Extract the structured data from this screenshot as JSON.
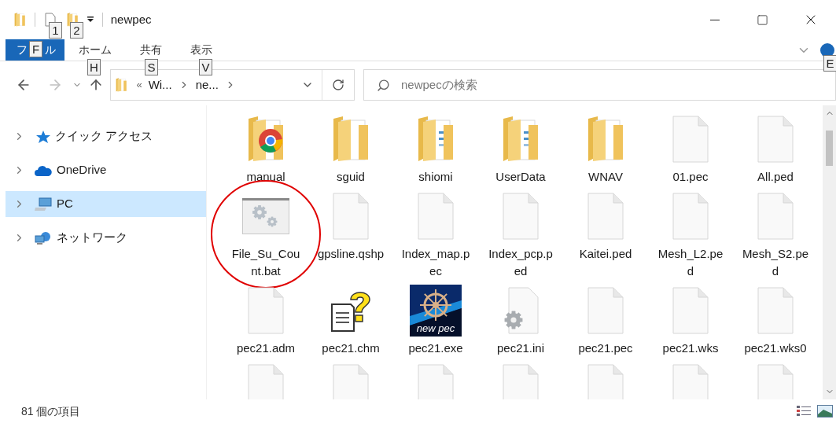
{
  "window": {
    "title": "newpec"
  },
  "keytips": [
    {
      "key": "1",
      "kind": "qat1"
    },
    {
      "key": "2",
      "kind": "qat2"
    },
    {
      "key": "F",
      "kind": "file"
    },
    {
      "key": "H",
      "kind": "home"
    },
    {
      "key": "S",
      "kind": "share"
    },
    {
      "key": "V",
      "kind": "view"
    },
    {
      "key": "E",
      "kind": "help"
    }
  ],
  "ribbon": {
    "file_tab": {
      "visible_parts": [
        "フ",
        "ル"
      ],
      "selected": true
    },
    "tabs": [
      {
        "label": "ホーム",
        "selected": false
      },
      {
        "label": "共有",
        "selected": false
      },
      {
        "label": "表示",
        "selected": false
      }
    ]
  },
  "address": {
    "overflow": "«",
    "crumbs": [
      "Wi...",
      "ne..."
    ]
  },
  "search": {
    "placeholder": "newpecの検索"
  },
  "sidebar": {
    "items": [
      {
        "label": "クイック アクセス",
        "kind": "quick",
        "selected": false
      },
      {
        "label": "OneDrive",
        "kind": "cloud",
        "selected": false
      },
      {
        "label": "PC",
        "kind": "pc",
        "selected": true
      },
      {
        "label": "ネットワーク",
        "kind": "network",
        "selected": false
      }
    ]
  },
  "items": [
    {
      "name": "manual",
      "kind": "folder-chrome",
      "circled": false
    },
    {
      "name": "sguid",
      "kind": "folder",
      "circled": false
    },
    {
      "name": "shiomi",
      "kind": "folder-docs",
      "circled": false
    },
    {
      "name": "UserData",
      "kind": "folder-docs",
      "circled": false
    },
    {
      "name": "WNAV",
      "kind": "folder",
      "circled": false
    },
    {
      "name": "01.pec",
      "kind": "file",
      "circled": false
    },
    {
      "name": "All.ped",
      "kind": "file",
      "circled": false
    },
    {
      "name": "File_Su_Count.bat",
      "kind": "bat",
      "circled": true
    },
    {
      "name": "gpsline.qshp",
      "kind": "file",
      "circled": false
    },
    {
      "name": "Index_map.pec",
      "kind": "file",
      "circled": false
    },
    {
      "name": "Index_pcp.ped",
      "kind": "file",
      "circled": false
    },
    {
      "name": "Kaitei.ped",
      "kind": "file",
      "circled": false
    },
    {
      "name": "Mesh_L2.ped",
      "kind": "file",
      "circled": false
    },
    {
      "name": "Mesh_S2.ped",
      "kind": "file",
      "circled": false
    },
    {
      "name": "pec21.adm",
      "kind": "file",
      "circled": false
    },
    {
      "name": "pec21.chm",
      "kind": "chm",
      "circled": false
    },
    {
      "name": "pec21.exe",
      "kind": "exe",
      "icon_text": "new pec",
      "circled": false
    },
    {
      "name": "pec21.ini",
      "kind": "ini",
      "circled": false
    },
    {
      "name": "pec21.pec",
      "kind": "file",
      "circled": false
    },
    {
      "name": "pec21.wks",
      "kind": "file",
      "circled": false
    },
    {
      "name": "pec21.wks0",
      "kind": "file",
      "circled": false
    },
    {
      "kind": "file",
      "circled": false
    },
    {
      "kind": "file",
      "circled": false
    },
    {
      "kind": "file",
      "circled": false
    },
    {
      "kind": "file",
      "circled": false
    },
    {
      "kind": "file",
      "circled": false
    },
    {
      "kind": "file",
      "circled": false
    },
    {
      "kind": "file",
      "circled": false
    }
  ],
  "status_bar": {
    "count": "81 個の項目"
  }
}
